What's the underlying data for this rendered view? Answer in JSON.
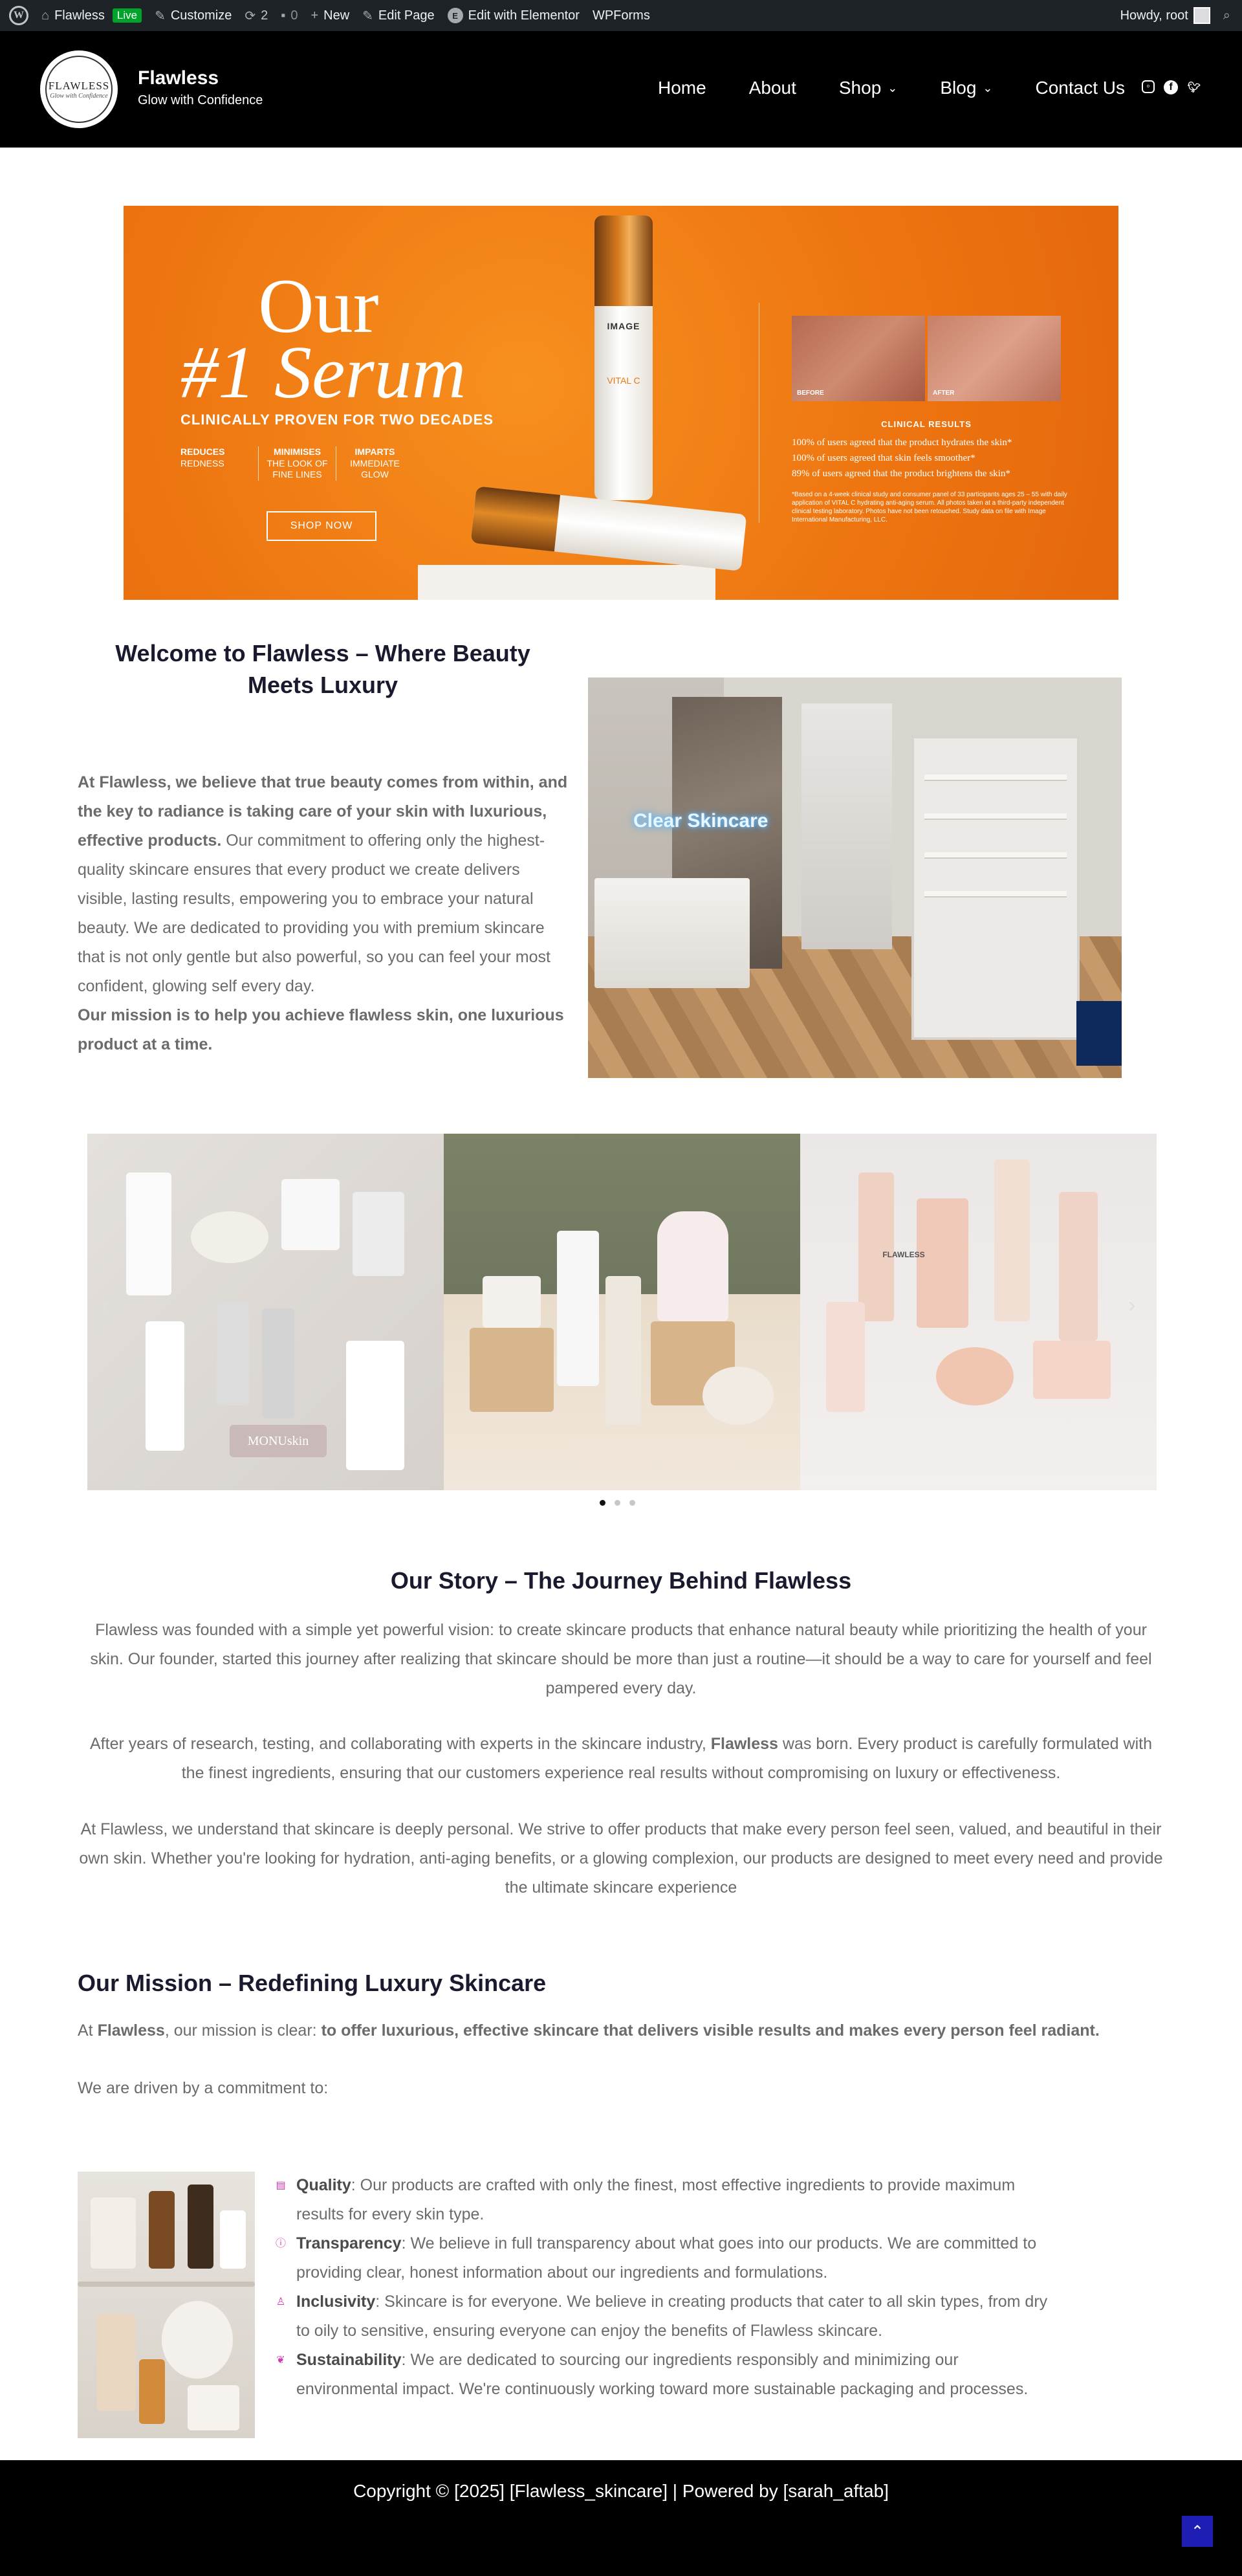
{
  "admin_bar": {
    "site_name": "Flawless",
    "live_badge": "Live",
    "customize": "Customize",
    "revisions_count": "2",
    "comments_count": "0",
    "new": "New",
    "edit_page": "Edit Page",
    "edit_elementor": "Edit with Elementor",
    "wpforms": "WPForms",
    "howdy": "Howdy, root"
  },
  "header": {
    "logo_text": "FLAWLESS",
    "logo_sub": "Glow with Confidence",
    "site_title": "Flawless",
    "tagline": "Glow with Confidence",
    "nav": [
      "Home",
      "About",
      "Shop",
      "Blog",
      "Contact Us"
    ]
  },
  "hero": {
    "title_line1": "Our",
    "title_line2": "#1 Serum",
    "subtitle": "CLINICALLY PROVEN FOR TWO DECADES",
    "benefits": [
      {
        "head": "REDUCES",
        "body": "REDNESS"
      },
      {
        "head": "MINIMISES",
        "body": "THE LOOK OF FINE LINES"
      },
      {
        "head": "IMPARTS",
        "body": "IMMEDIATE GLOW"
      }
    ],
    "button": "SHOP NOW",
    "bottle_brand": "IMAGE",
    "bottle_product": "VITAL C",
    "before_label": "BEFORE",
    "after_label": "AFTER",
    "clinical_title": "CLINICAL RESULTS",
    "clinical_lines": [
      "100% of users agreed that the product hydrates the skin*",
      "100% of users agreed that skin feels smoother*",
      "89% of users agreed that the product brightens the skin*"
    ],
    "clinical_note": "*Based on a 4-week clinical study and consumer panel of 33 participants ages 25 – 55 with daily application of VITAL C hydrating anti-aging serum. All photos taken at a third-party independent clinical testing laboratory. Photos have not been retouched. Study data on file with Image International Manufacturing, LLC."
  },
  "welcome": {
    "title": "Welcome to Flawless – Where Beauty Meets Luxury",
    "intro_bold": "At Flawless, we believe that true beauty comes from within, and the key to radiance is taking care of your skin with luxurious, effective products.",
    "body": " Our commitment to offering only the highest-quality skincare ensures that every product we create delivers visible, lasting results, empowering you to embrace your natural beauty. We are dedicated to providing you with premium skincare that is not only gentle but also powerful, so you can feel your most confident, glowing self every day.",
    "mission_bold": "Our mission is to help you achieve flawless skin, one luxurious product at a time.",
    "neon_sign": "Clear Skincare"
  },
  "carousel": {
    "brand_text_1": "MONUskin",
    "brand_text_3": "FLAWLESS"
  },
  "story": {
    "title": "Our Story – The Journey Behind Flawless",
    "p1": "Flawless was founded with a simple yet powerful vision: to create skincare products that enhance natural beauty while prioritizing the health of your skin. Our founder, started this journey after realizing that skincare should be more than just a routine—it should be a way to care for yourself and feel pampered every day.",
    "p2_before": "After years of research, testing, and collaborating with experts in the skincare industry, ",
    "p2_bold": "Flawless",
    "p2_after": " was born. Every product is carefully formulated with the finest ingredients, ensuring that our customers experience real results without compromising on luxury or effectiveness.",
    "p3": "At Flawless, we understand that skincare is deeply personal. We strive to offer products that make every person feel seen, valued, and beautiful in their own skin. Whether you're looking for hydration, anti-aging benefits, or a glowing complexion, our products are designed to meet every need and provide the ultimate skincare experience"
  },
  "mission": {
    "title": "Our Mission – Redefining Luxury Skincare",
    "intro_at": "At ",
    "intro_brand": "Flawless",
    "intro_mid": ", our mission is clear: ",
    "intro_bold": "to offer luxurious, effective skincare that delivers visible results and makes every person feel radiant.",
    "driven": "We are driven by a commitment to:",
    "values": [
      {
        "name": "Quality",
        "text": ": Our products are crafted with only the finest, most effective ingredients to provide maximum results for every skin type."
      },
      {
        "name": "Transparency",
        "text": ": We believe in full transparency about what goes into our products. We are committed to providing clear, honest information about our ingredients and formulations."
      },
      {
        "name": "Inclusivity",
        "text": ": Skincare is for everyone. We believe in creating products that cater to all skin types, from dry to oily to sensitive, ensuring everyone can enjoy the benefits of Flawless skincare."
      },
      {
        "name": "Sustainability",
        "text": ": We are dedicated to sourcing our ingredients responsibly and minimizing our environmental impact. We're continuously working toward more sustainable packaging and processes."
      }
    ]
  },
  "footer": {
    "copyright": "Copyright © [2025] [Flawless_skincare] | Powered by [sarah_aftab]"
  },
  "colors": {
    "admin_bar": "#1d2327",
    "header_bg": "#000000",
    "hero_orange": "#ee7611",
    "heading": "#1a1a2e",
    "body_text": "#6b6b6b",
    "icon_accent": "#d03ab0",
    "scroll_top": "#1e1eb4"
  }
}
